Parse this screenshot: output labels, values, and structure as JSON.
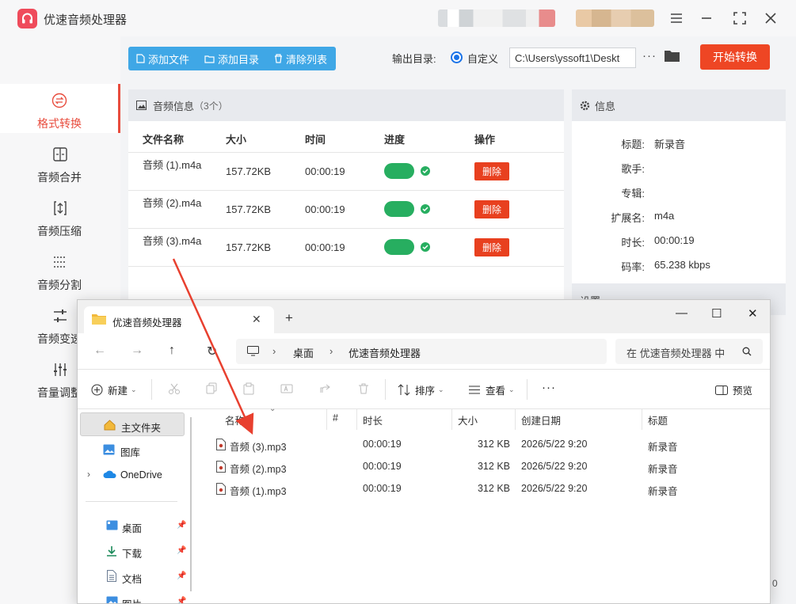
{
  "app": {
    "title": "优速音频处理器",
    "accent": "#e84c3d",
    "user_redacted": true
  },
  "sidebar": {
    "items": [
      {
        "label": "格式转换",
        "icon": "format-convert-icon",
        "active": true
      },
      {
        "label": "音频合并",
        "icon": "merge-icon"
      },
      {
        "label": "音频压缩",
        "icon": "compress-icon"
      },
      {
        "label": "音频分割",
        "icon": "split-icon"
      },
      {
        "label": "音频变速",
        "icon": "speed-icon"
      },
      {
        "label": "音量调整",
        "icon": "volume-icon"
      }
    ]
  },
  "toolbar": {
    "add_file": "添加文件",
    "add_dir": "添加目录",
    "clear_list": "清除列表",
    "output_label": "输出目录:",
    "custom_label": "自定义",
    "output_path": "C:\\Users\\yssoft1\\Deskt",
    "start_label": "开始转换"
  },
  "audio_panel": {
    "title": "音频信息",
    "count": "（3个）",
    "columns": [
      "文件名称",
      "大小",
      "时间",
      "进度",
      "操作"
    ],
    "rows": [
      {
        "name": "音频 (1).m4a",
        "size": "157.72KB",
        "time": "00:00:19",
        "progress": 1.0,
        "action": "删除"
      },
      {
        "name": "音频 (2).m4a",
        "size": "157.72KB",
        "time": "00:00:19",
        "progress": 1.0,
        "action": "删除"
      },
      {
        "name": "音频 (3).m4a",
        "size": "157.72KB",
        "time": "00:00:19",
        "progress": 1.0,
        "action": "删除"
      }
    ]
  },
  "info_panel": {
    "title": "信息",
    "fields": [
      {
        "key": "标题:",
        "value": "新录音"
      },
      {
        "key": "歌手:",
        "value": ""
      },
      {
        "key": "专辑:",
        "value": ""
      },
      {
        "key": "扩展名:",
        "value": "m4a"
      },
      {
        "key": "时长:",
        "value": "00:00:19"
      },
      {
        "key": "码率:",
        "value": "65.238 kbps"
      }
    ],
    "settings_title": "设置"
  },
  "explorer": {
    "tab_title": "优速音频处理器",
    "breadcrumb": [
      "桌面",
      "优速音频处理器"
    ],
    "search_placeholder": "在 优速音频处理器 中",
    "commands": {
      "new": "新建",
      "sort": "排序",
      "view": "查看",
      "more": "···",
      "preview": "预览"
    },
    "nav": [
      {
        "label": "主文件夹",
        "icon": "home-icon"
      },
      {
        "label": "图库",
        "icon": "gallery-icon"
      },
      {
        "label": "OneDrive",
        "icon": "onedrive-icon"
      },
      {
        "label": "桌面",
        "icon": "desktop-icon"
      },
      {
        "label": "下载",
        "icon": "download-icon"
      },
      {
        "label": "文档",
        "icon": "document-icon"
      },
      {
        "label": "图片",
        "icon": "picture-icon"
      }
    ],
    "columns": [
      "名称",
      "#",
      "时长",
      "大小",
      "创建日期",
      "标题"
    ],
    "files": [
      {
        "name": "音频 (3).mp3",
        "duration": "00:00:19",
        "size": "312 KB",
        "created": "2026/5/22 9:20",
        "title": "新录音"
      },
      {
        "name": "音频 (2).mp3",
        "duration": "00:00:19",
        "size": "312 KB",
        "created": "2026/5/22 9:20",
        "title": "新录音"
      },
      {
        "name": "音频 (1).mp3",
        "duration": "00:00:19",
        "size": "312 KB",
        "created": "2026/5/22 9:20",
        "title": "新录音"
      }
    ]
  },
  "background_status": "0"
}
